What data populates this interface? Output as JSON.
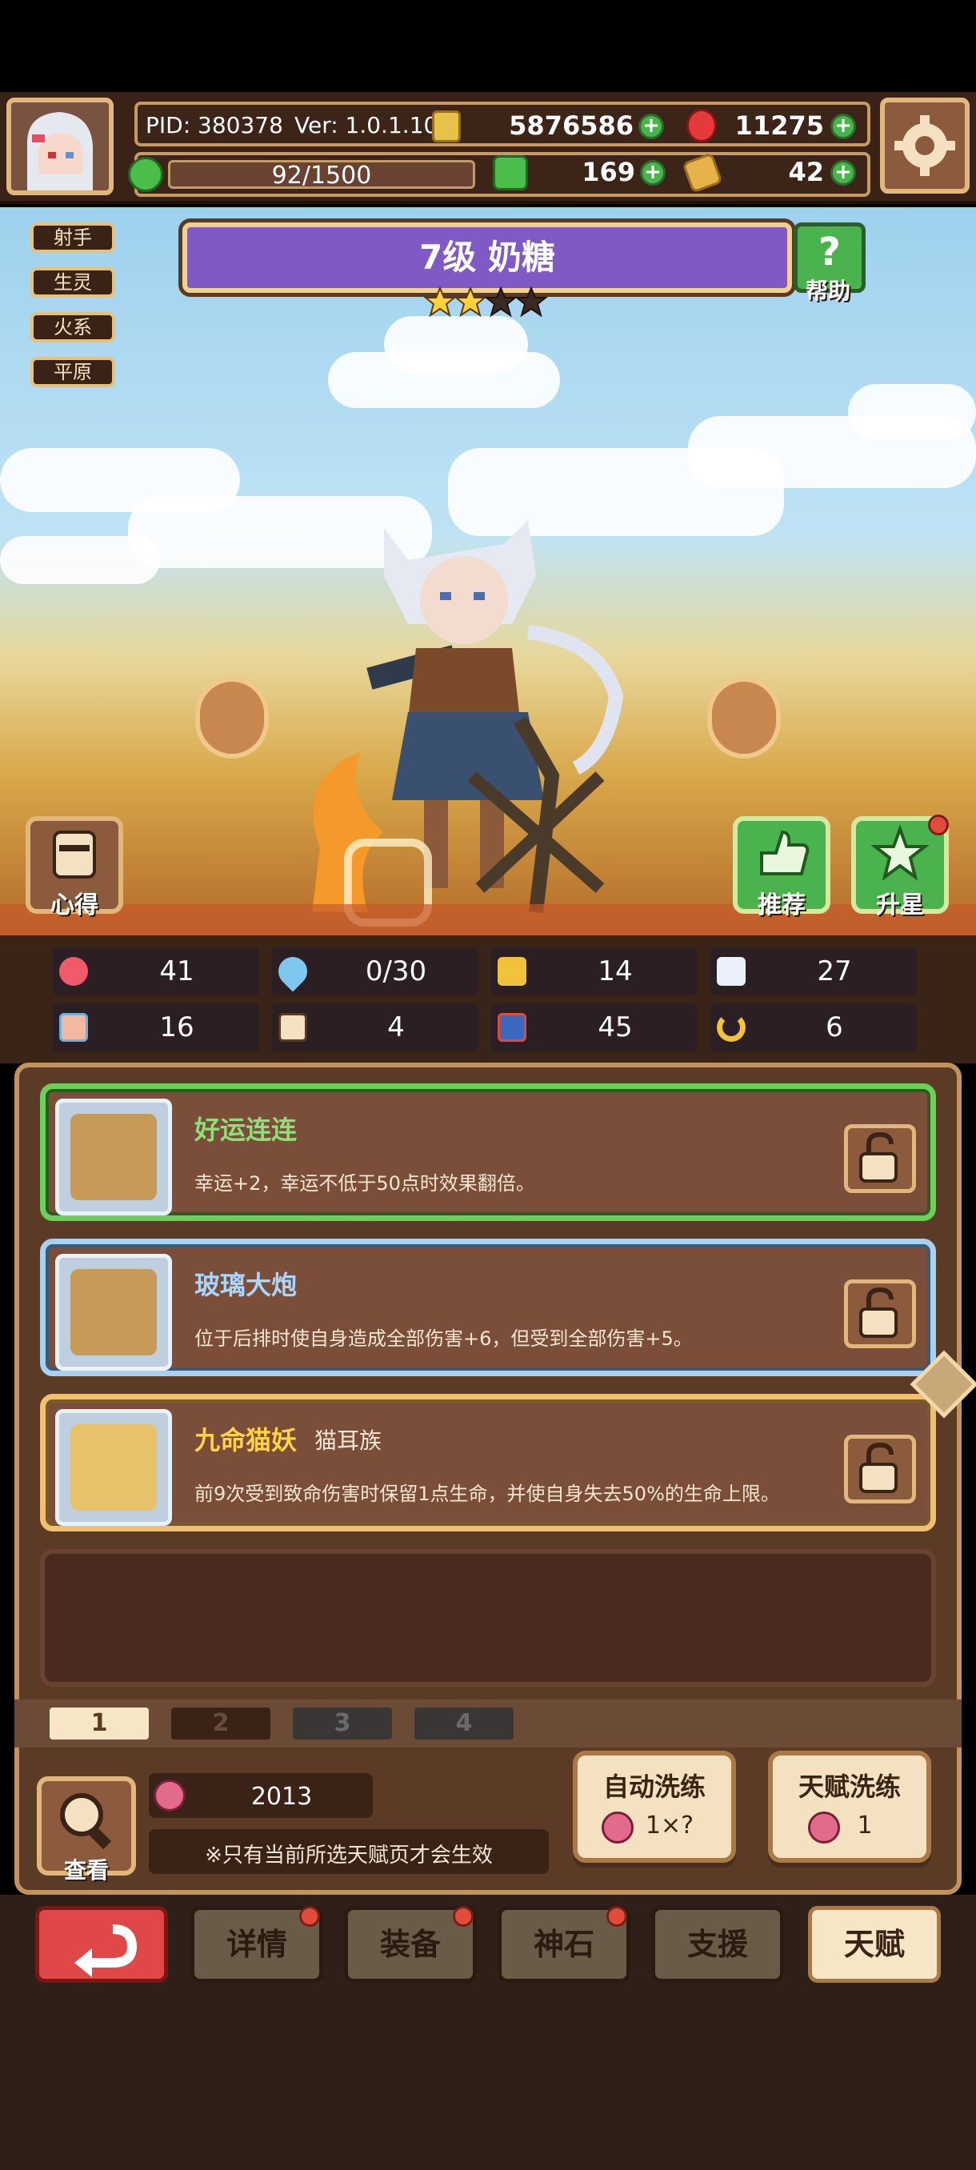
{
  "header": {
    "pid": "PID: 380378",
    "version": "Ver: 1.0.1.10",
    "gold": "5876586",
    "gems": "11275",
    "stamina": "92/1500",
    "clover": "169",
    "tickets": "42"
  },
  "tags": [
    "射手",
    "生灵",
    "火系",
    "平原"
  ],
  "hero": {
    "title": "7级  奶糖",
    "stars_filled": 2,
    "stars_total": 4,
    "help_label": "帮助"
  },
  "buttons": {
    "notes": "心得",
    "recommend": "推荐",
    "star_up": "升星"
  },
  "stats": [
    "41",
    "0/30",
    "14",
    "27",
    "16",
    "4",
    "45",
    "6"
  ],
  "traits": [
    {
      "title": "好运连连",
      "suffix": "",
      "desc": "幸运+2，幸运不低于50点时效果翻倍。",
      "color": "#8fe07a"
    },
    {
      "title": "玻璃大炮",
      "suffix": "",
      "desc": "位于后排时使自身造成全部伤害+6，但受到全部伤害+5。",
      "color": "#a8d6ff"
    },
    {
      "title": "九命猫妖",
      "suffix": "猫耳族",
      "desc": "前9次受到致命伤害时保留1点生命，并使自身失去50%的生命上限。",
      "color": "#ffd24a"
    }
  ],
  "pages": [
    "1",
    "2",
    "3",
    "4"
  ],
  "bottom": {
    "view_label": "查看",
    "peach_count": "2013",
    "note": "※只有当前所选天赋页才会生效",
    "auto_reroll": "自动洗练",
    "auto_cost": "1×?",
    "talent_reroll": "天赋洗练",
    "talent_cost": "1"
  },
  "nav": [
    "详情",
    "装备",
    "神石",
    "支援",
    "天赋"
  ],
  "colors": {
    "accent_purple": "#7f5ac4",
    "panel_brown": "#5b3a26",
    "active_tab": "#f6e6c6"
  }
}
